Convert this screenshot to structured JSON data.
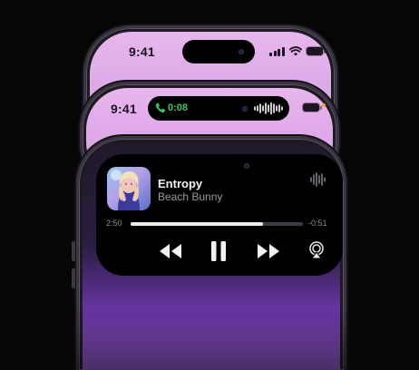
{
  "phones": {
    "back": {
      "time": "9:41"
    },
    "middle": {
      "time": "9:41",
      "call_duration": "0:08"
    },
    "front": {
      "now_playing": {
        "title": "Entropy",
        "artist": "Beach Bunny",
        "elapsed": "2:50",
        "remaining": "-0:51",
        "progress": 0.77
      }
    }
  },
  "icons": {
    "status": [
      "signal-icon",
      "wifi-icon",
      "battery-icon"
    ],
    "call": [
      "phone-call-icon",
      "audio-waveform-icon"
    ],
    "player": [
      "equalizer-icon",
      "previous-track-icon",
      "pause-icon",
      "next-track-icon",
      "airplay-icon"
    ]
  },
  "colors": {
    "background": "#060606",
    "screen_lavender": "#e4b4ec",
    "call_green": "#34c759",
    "recording_dot": "#ff9a2e",
    "island": "#000000"
  }
}
